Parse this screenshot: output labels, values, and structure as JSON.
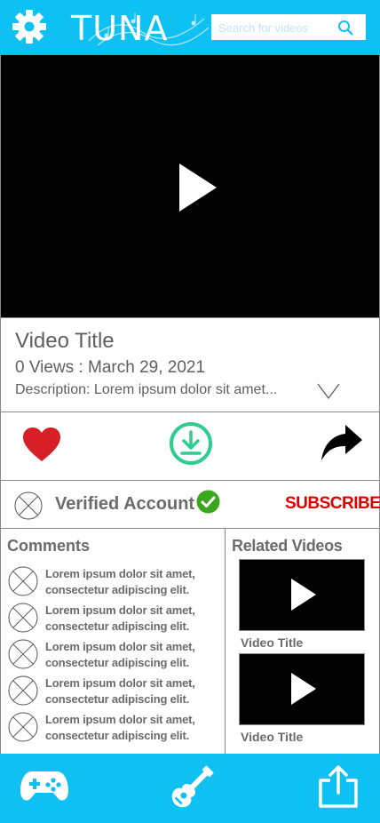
{
  "header": {
    "logo": "TUNA",
    "search_placeholder": "Search for videos",
    "icons": {
      "settings": "gear-icon",
      "search": "search-icon"
    }
  },
  "player": {
    "icon": "play-icon"
  },
  "video": {
    "title": "Video Title",
    "views": "0 Views : March 29, 2021",
    "description": "Description: Lorem ipsum dolor sit amet..."
  },
  "actions": {
    "like_icon": "heart-icon",
    "download_icon": "download-icon",
    "share_icon": "share-arrow-icon"
  },
  "account": {
    "label": "Verified Account",
    "subscribe": "SUBSCRIBE"
  },
  "comments": {
    "title": "Comments",
    "items": [
      {
        "line1": "Lorem ipsum dolor sit amet,",
        "line2": "consectetur adipiscing elit."
      },
      {
        "line1": "Lorem ipsum dolor sit amet,",
        "line2": "consectetur adipiscing elit."
      },
      {
        "line1": "Lorem ipsum dolor sit amet,",
        "line2": "consectetur adipiscing elit."
      },
      {
        "line1": "Lorem ipsum dolor sit amet,",
        "line2": "consectetur adipiscing elit."
      },
      {
        "line1": "Lorem ipsum dolor sit amet,",
        "line2": "consectetur adipiscing elit."
      }
    ]
  },
  "related": {
    "title": "Related Videos",
    "items": [
      {
        "label": "Video Title"
      },
      {
        "label": "Video Title"
      }
    ]
  },
  "nav": {
    "icons": [
      "gamepad-icon",
      "guitar-icon",
      "share-upload-icon"
    ]
  },
  "colors": {
    "brand": "#0fc0f3",
    "subscribe": "#e00000",
    "like": "#d61f26",
    "download": "#2ecc8f",
    "verified": "#3aa81e"
  }
}
